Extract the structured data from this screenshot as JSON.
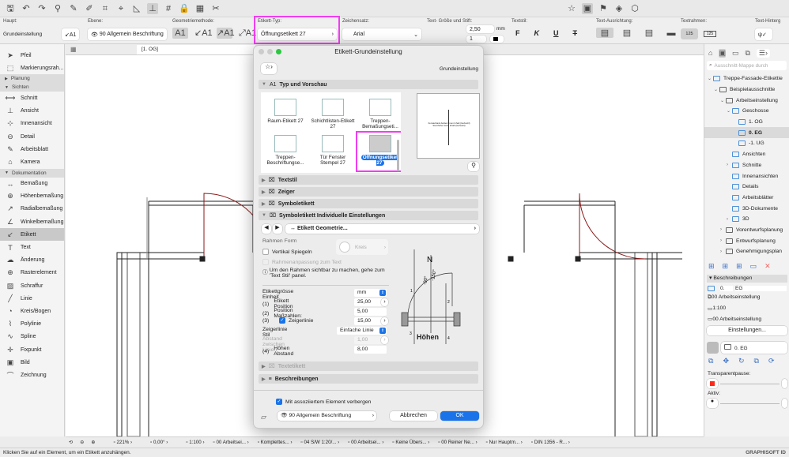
{
  "toolbar": {
    "icons": [
      "save-icon",
      "undo-icon",
      "redo-icon",
      "find-icon",
      "eyedropper-icon",
      "syringe-icon",
      "magic-wand-icon",
      "intersect-icon",
      "guide-icon",
      "snap-icon",
      "grid-icon",
      "lock-icon",
      "layer-icon",
      "trace-icon",
      "favorite-icon",
      "view-icon",
      "flag-icon",
      "renovation-icon",
      "3d-icon"
    ]
  },
  "info_box": {
    "haupt_label": "Haupt:",
    "haupt_value": "Grundeinstellung",
    "ebene_label": "Ebene:",
    "ebene_value": "90 Allgemein Beschriftung",
    "geometrie_label": "Geometriemethode:",
    "etikett_typ_label": "Etikett-Typ:",
    "etikett_typ_value": "Öffnungsetikett 27",
    "zeichensatz_label": "Zeichensatz:",
    "zeichensatz_value": "Arial",
    "text_groesse_label": "Text- Größe und Stift:",
    "text_groesse_value": "2,50",
    "text_groesse_unit": "mm",
    "stift_value": "1",
    "textstil_label": "Textstil:",
    "textstil_buttons": [
      "F",
      "K",
      "U",
      "T"
    ],
    "ausrichtung_label": "Text-Ausrichtung:",
    "textrahmen_label": "Textrahmen:",
    "textrahmen_value": "125",
    "hintergrund_label": "Text-Hinterg"
  },
  "toolbox": {
    "items": [
      {
        "type": "item",
        "label": "Pfeil",
        "icon": "arrow-icon"
      },
      {
        "type": "item",
        "label": "Markierungsrah...",
        "icon": "marquee-icon"
      },
      {
        "type": "group",
        "label": "Planung",
        "open": false
      },
      {
        "type": "group",
        "label": "Sichten",
        "open": true
      },
      {
        "type": "item",
        "label": "Schnitt",
        "icon": "section-icon"
      },
      {
        "type": "item",
        "label": "Ansicht",
        "icon": "elevation-icon"
      },
      {
        "type": "item",
        "label": "Innenansicht",
        "icon": "interior-elevation-icon"
      },
      {
        "type": "item",
        "label": "Detail",
        "icon": "detail-icon"
      },
      {
        "type": "item",
        "label": "Arbeitsblatt",
        "icon": "worksheet-icon"
      },
      {
        "type": "item",
        "label": "Kamera",
        "icon": "camera-icon"
      },
      {
        "type": "group",
        "label": "Dokumentation",
        "open": true
      },
      {
        "type": "item",
        "label": "Bemaßung",
        "icon": "dimension-icon"
      },
      {
        "type": "item",
        "label": "Höhenbemaßung",
        "icon": "level-dimension-icon"
      },
      {
        "type": "item",
        "label": "Radialbemaßung",
        "icon": "radial-dimension-icon"
      },
      {
        "type": "item",
        "label": "Winkelbemaßung",
        "icon": "angle-dimension-icon"
      },
      {
        "type": "item",
        "label": "Etikett",
        "icon": "label-icon",
        "selected": true
      },
      {
        "type": "item",
        "label": "Text",
        "icon": "text-icon"
      },
      {
        "type": "item",
        "label": "Änderung",
        "icon": "change-icon"
      },
      {
        "type": "item",
        "label": "Rasterelement",
        "icon": "grid-element-icon"
      },
      {
        "type": "item",
        "label": "Schraffur",
        "icon": "fill-icon"
      },
      {
        "type": "item",
        "label": "Linie",
        "icon": "line-icon"
      },
      {
        "type": "item",
        "label": "Kreis/Bogen",
        "icon": "arc-icon"
      },
      {
        "type": "item",
        "label": "Polylinie",
        "icon": "polyline-icon"
      },
      {
        "type": "item",
        "label": "Spline",
        "icon": "spline-icon"
      },
      {
        "type": "item",
        "label": "Fixpunkt",
        "icon": "hotspot-icon"
      },
      {
        "type": "item",
        "label": "Bild",
        "icon": "image-icon"
      },
      {
        "type": "item",
        "label": "Zeichnung",
        "icon": "drawing-icon"
      }
    ]
  },
  "canvas": {
    "tab": "[1. OG]"
  },
  "dialog": {
    "title": "Etikett-Grundeinstellung",
    "preset": "Grundeinstellung",
    "sections": {
      "typ": "Typ und Vorschau",
      "textstil": "Textstil",
      "zeiger": "Zeiger",
      "symboletikett": "Symboletikett",
      "individuell": "Symboletikett Individuelle Einstellungen",
      "textetikett": "Textetikett",
      "beschreibungen": "Beschreibungen"
    },
    "library": [
      {
        "label": "Raum-Etikett 27"
      },
      {
        "label": "Schichtlisten-Etikett 27"
      },
      {
        "label": "Treppen-Bemaßungseti..."
      },
      {
        "label": "Treppen-Beschriftungse..."
      },
      {
        "label": "Tür Fenster Stempel 27"
      },
      {
        "label": "Öffnungsetikett 27",
        "selected": true
      }
    ],
    "preview_text": "Fensterbank Außen/Innen Inhalt (Gehsohl) Sturzhöhe Innen Inhalt (Gehsohl)",
    "page_nav": "Etikett Geometrie...",
    "rahmen_form_label": "Rahmen Form",
    "rahmen_form_value": "Kreis",
    "vertikal_spiegeln": "Vertikal Spiegeln",
    "rahmenanpassung": "Rahmenanpassung zum Text",
    "info_text": "Um den Rahmen sichtbar zu machen, gehe zum 'Text Stil' panel.",
    "params": [
      {
        "num": "",
        "label": "Etikettgrösse Einheit",
        "value": "mm"
      },
      {
        "num": "(1)",
        "label": "Etikett Position",
        "value": "25,00"
      },
      {
        "num": "(2)",
        "label": "Position Maßzahlen:",
        "value": "5,00"
      },
      {
        "num": "(3)",
        "label": "Zeigerlinie",
        "value": "15,00",
        "checked": true
      },
      {
        "num": "",
        "label": "Zeigerlinie Stil",
        "value": "Einfache Linie"
      },
      {
        "num": "",
        "label": "Abstand zwischen Linien",
        "value": "1,00",
        "disabled": true
      },
      {
        "num": "(4)",
        "label": "Höhen Abstand",
        "value": "8,00"
      }
    ],
    "diagram": {
      "north": "N",
      "angle1": "-90°",
      "angle2": "-150°",
      "caption": "Höhen",
      "marks": [
        "1",
        "2",
        "3",
        "4"
      ]
    },
    "hide_checkbox": "Mit assoziiertem Element verbergen",
    "layer": "90 Allgemein Beschriftung",
    "cancel": "Abbrechen",
    "ok": "OK"
  },
  "navigator": {
    "search_placeholder": "Ausschnitt-Mappe durch",
    "tree": [
      {
        "level": 0,
        "label": "Treppe-Fassade-Etikettie"
      },
      {
        "level": 1,
        "label": "Beispielausschnitte"
      },
      {
        "level": 2,
        "label": "Arbeitseinstellung"
      },
      {
        "level": 3,
        "label": "Geschosse"
      },
      {
        "level": 4,
        "label": "1. OG"
      },
      {
        "level": 4,
        "label": "0. EG",
        "selected": true
      },
      {
        "level": 4,
        "label": "-1. UG"
      },
      {
        "level": 3,
        "label": "Ansichten"
      },
      {
        "level": 3,
        "label": "Schnitte"
      },
      {
        "level": 3,
        "label": "Innenansichten"
      },
      {
        "level": 3,
        "label": "Details"
      },
      {
        "level": 3,
        "label": "Arbeitsblätter"
      },
      {
        "level": 3,
        "label": "3D-Dokumente"
      },
      {
        "level": 3,
        "label": "3D"
      },
      {
        "level": 2,
        "label": "Vorentwurfsplanung"
      },
      {
        "level": 2,
        "label": "Entwurfsplanung"
      },
      {
        "level": 2,
        "label": "Genehmigungsplan"
      }
    ],
    "beschreibungen": "Beschreibungen",
    "id": "0.",
    "name": "EG",
    "layer": "00 Arbeitseinstellung",
    "scale": "1:100",
    "model": "00 Arbeitseinstellung",
    "einstellungen": "Einstellungen...",
    "view": "0. EG",
    "transparent_label": "Transparentpause:",
    "aktiv_label": "Aktiv:",
    "transparent_color": "#ff2a1a"
  },
  "statusbar": [
    "221%",
    "0,00°",
    "1:100",
    "00 Arbeitsei...",
    "Komplettes...",
    "04 S/W 1:20/...",
    "00 Arbeitsei...",
    "Keine Übers...",
    "00 Reiner Ne...",
    "Nur Hauptm...",
    "DIN 1356 - R..."
  ],
  "message": "Klicken Sie auf ein Element, um ein Etikett anzuhängen.",
  "brand": "GRAPHISOFT ID",
  "colors": {
    "accent": "#1a73e8",
    "highlight": "#f03df0"
  }
}
